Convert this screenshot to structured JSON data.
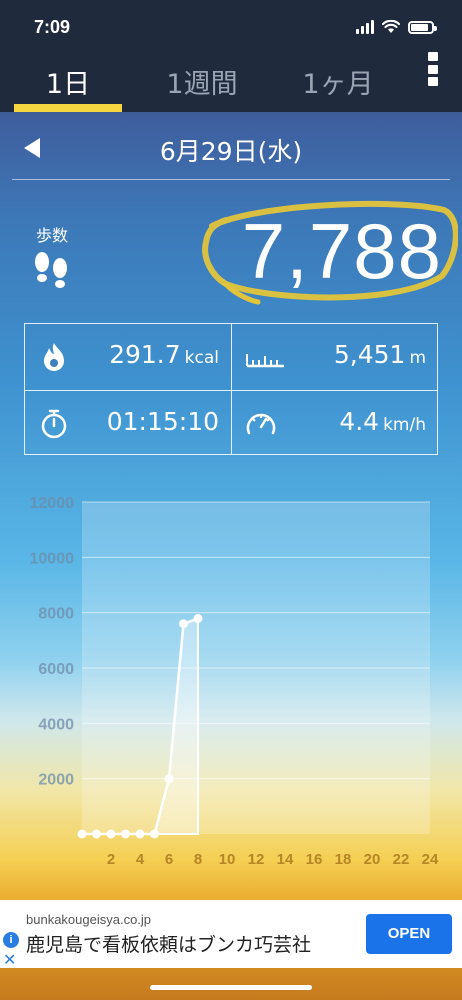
{
  "status_bar": {
    "time": "7:09",
    "battery_level": 0.85
  },
  "tabs": [
    {
      "label": "1日",
      "active": true
    },
    {
      "label": "1週間",
      "active": false
    },
    {
      "label": "1ヶ月",
      "active": false
    }
  ],
  "date": {
    "label": "6月29日(水)"
  },
  "steps": {
    "label": "歩数",
    "value": "7,788"
  },
  "stats": {
    "calories": {
      "value": "291.7",
      "unit": "kcal",
      "icon": "flame-icon"
    },
    "distance": {
      "value": "5,451",
      "unit": "m",
      "icon": "ruler-icon"
    },
    "duration": {
      "value": "01:15:10",
      "icon": "stopwatch-icon"
    },
    "speed": {
      "value": "4.4",
      "unit": "km/h",
      "icon": "speedometer-icon"
    }
  },
  "colors": {
    "accent": "#f6d640",
    "tab_bar": "#1f2a3d",
    "ad_button": "#1a73e8"
  },
  "chart_data": {
    "type": "line",
    "x": [
      0,
      1,
      2,
      3,
      4,
      5,
      6,
      7,
      8
    ],
    "values": [
      0,
      0,
      0,
      0,
      0,
      0,
      2000,
      7600,
      7788
    ],
    "xticks": [
      "2",
      "4",
      "6",
      "8",
      "10",
      "12",
      "14",
      "16",
      "18",
      "20",
      "22",
      "24"
    ],
    "yticks": [
      "2000",
      "4000",
      "6000",
      "8000",
      "10000",
      "12000"
    ],
    "xlim": [
      0,
      24
    ],
    "ylim": [
      0,
      12000
    ],
    "grid": true
  },
  "ad": {
    "domain": "bunkakougeisya.co.jp",
    "title": "鹿児島で看板依頼はブンカ巧芸社",
    "button_label": "OPEN",
    "info_glyph": "i",
    "close_glyph": "✕"
  }
}
